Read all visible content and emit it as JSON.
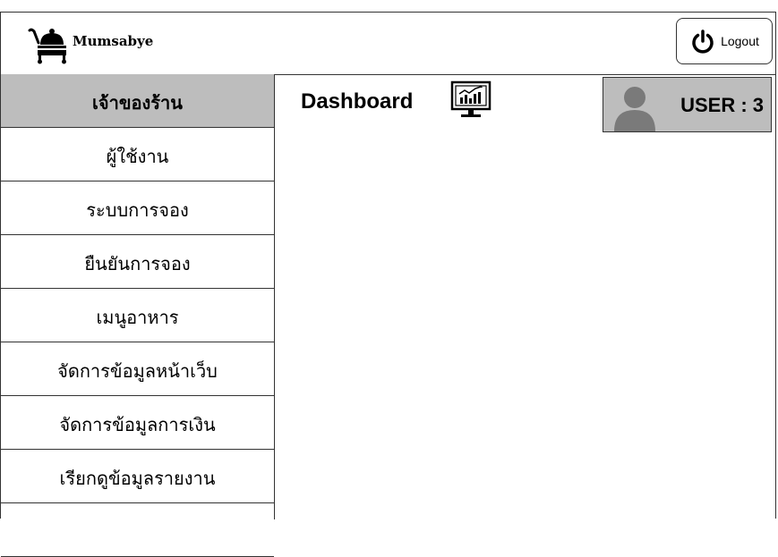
{
  "brand": {
    "name": "Mumsabye",
    "icon": "food-cart-icon"
  },
  "header": {
    "logout_label": "Logout",
    "logout_icon": "power-icon"
  },
  "sidebar": {
    "heading": "เจ้าของร้าน",
    "items": [
      {
        "label": "ผู้ใช้งาน"
      },
      {
        "label": "ระบบการจอง"
      },
      {
        "label": "ยืนยันการจอง"
      },
      {
        "label": "เมนูอาหาร"
      },
      {
        "label": "จัดการข้อมูลหน้าเว็บ"
      },
      {
        "label": "จัดการข้อมูลการเงิน"
      },
      {
        "label": "เรียกดูข้อมูลรายงาน"
      },
      {
        "label": ""
      }
    ]
  },
  "main": {
    "title": "Dashboard",
    "title_icon": "dashboard-monitor-icon"
  },
  "user": {
    "label": "USER : 3",
    "icon": "user-avatar-icon"
  },
  "colors": {
    "accent_gray": "#bdbdbd",
    "border": "#333333"
  }
}
